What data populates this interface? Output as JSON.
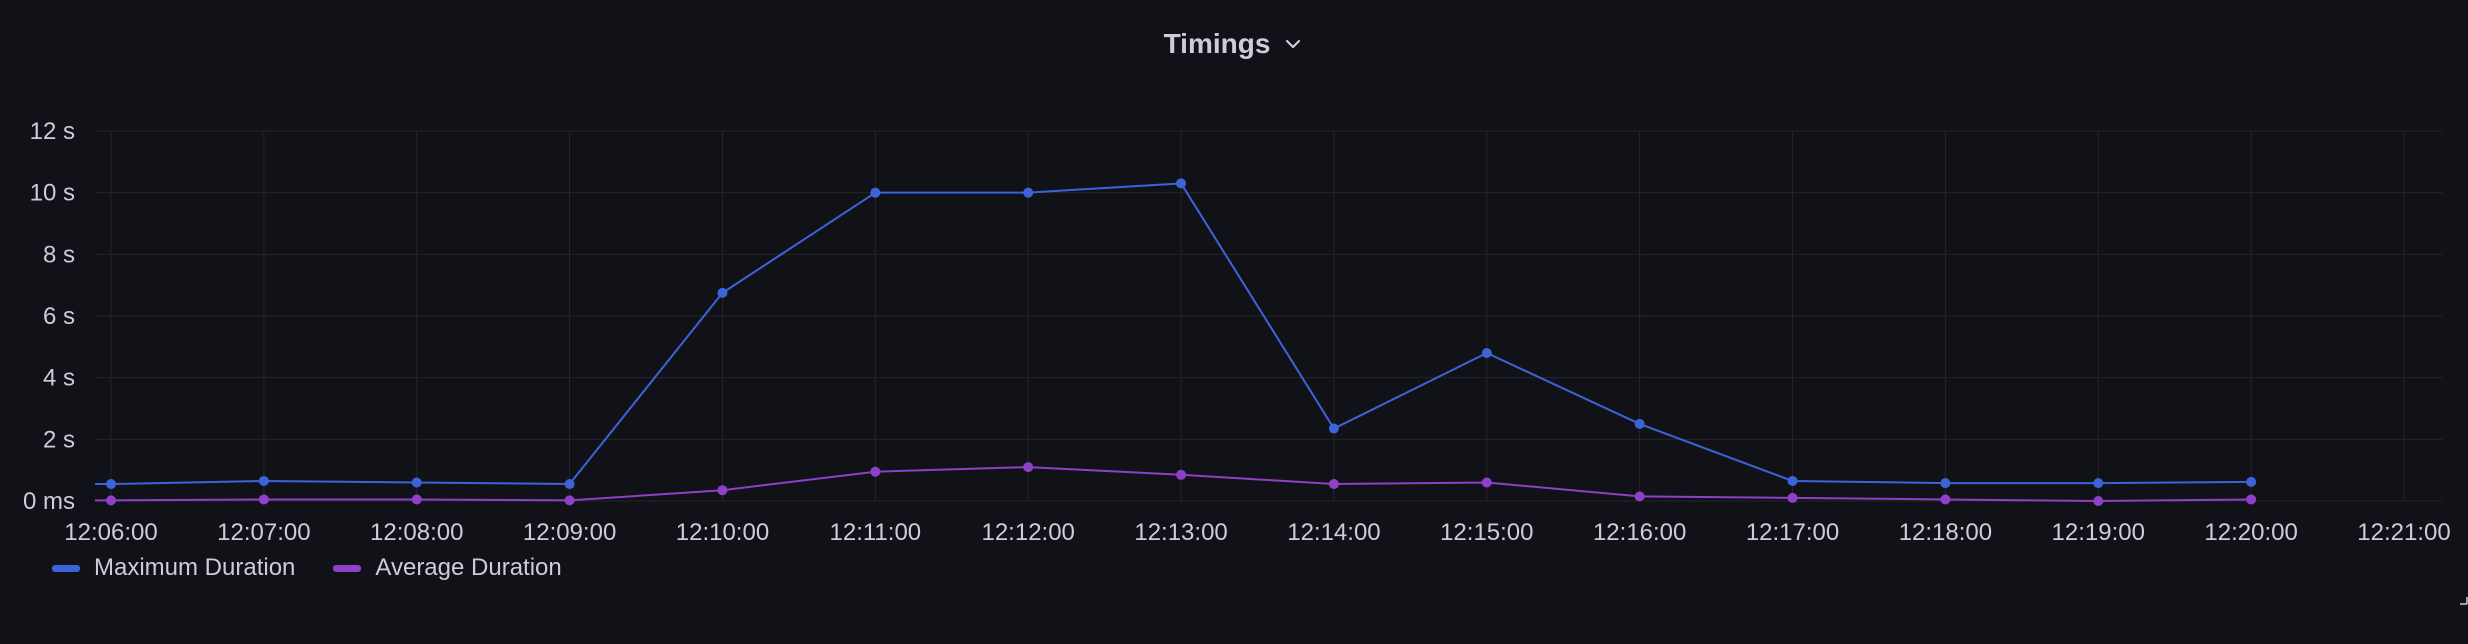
{
  "panel": {
    "title": "Timings",
    "menu_icon": "chevron-down-icon"
  },
  "colors": {
    "background": "#111217",
    "grid": "#24262c",
    "text": "#ccccdc",
    "max_series": "#3d63d8",
    "avg_series": "#8e40c8"
  },
  "legend": {
    "items": [
      {
        "label": "Maximum Duration",
        "color": "#3d63d8"
      },
      {
        "label": "Average Duration",
        "color": "#8e40c8"
      }
    ],
    "placement": "bottom-left"
  },
  "chart_data": {
    "type": "line",
    "title": "Timings",
    "xlabel": "",
    "ylabel": "",
    "grid": true,
    "x": [
      "12:06:00",
      "12:07:00",
      "12:08:00",
      "12:09:00",
      "12:10:00",
      "12:11:00",
      "12:12:00",
      "12:13:00",
      "12:14:00",
      "12:15:00",
      "12:16:00",
      "12:17:00",
      "12:18:00",
      "12:19:00",
      "12:20:00"
    ],
    "x_ticks": [
      "12:06:00",
      "12:07:00",
      "12:08:00",
      "12:09:00",
      "12:10:00",
      "12:11:00",
      "12:12:00",
      "12:13:00",
      "12:14:00",
      "12:15:00",
      "12:16:00",
      "12:17:00",
      "12:18:00",
      "12:19:00",
      "12:20:00",
      "12:21:00"
    ],
    "y_ticks": [
      "0 ms",
      "2 s",
      "4 s",
      "6 s",
      "8 s",
      "10 s",
      "12 s"
    ],
    "y_unit": "s",
    "ylim": [
      0,
      12
    ],
    "xlim": [
      "12:06:00",
      "12:21:00"
    ],
    "series": [
      {
        "name": "Maximum Duration",
        "values": [
          0.55,
          0.65,
          0.6,
          0.55,
          6.75,
          10.0,
          10.0,
          10.3,
          2.35,
          4.8,
          2.5,
          0.65,
          0.58,
          0.58,
          0.62
        ]
      },
      {
        "name": "Average Duration",
        "values": [
          0.02,
          0.05,
          0.05,
          0.02,
          0.35,
          0.95,
          1.1,
          0.85,
          0.55,
          0.6,
          0.15,
          0.1,
          0.05,
          0.0,
          0.05
        ]
      }
    ]
  }
}
